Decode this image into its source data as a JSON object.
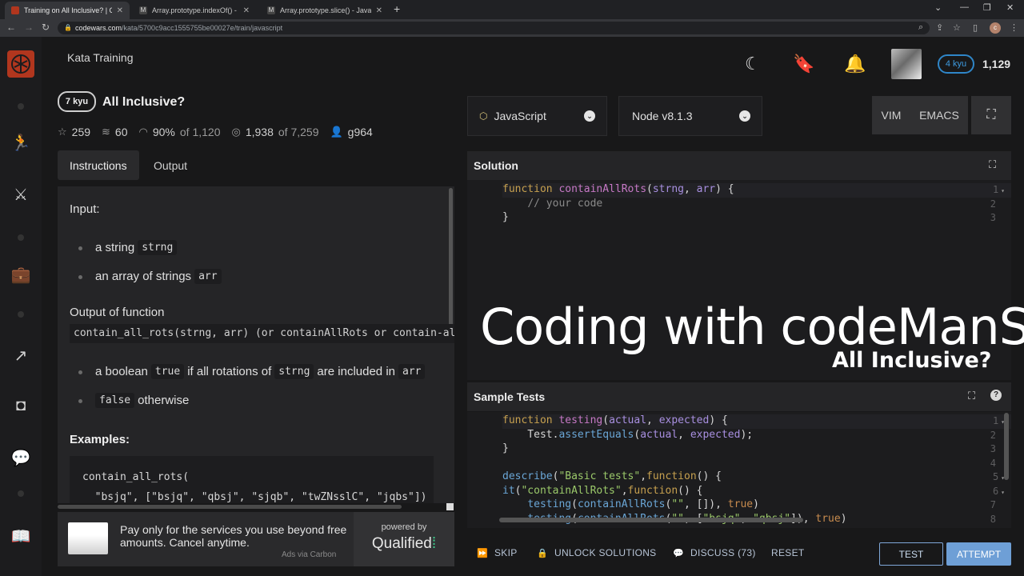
{
  "browser": {
    "tabs": [
      {
        "title": "Training on All Inclusive? | Codewars",
        "color": "#b1361e"
      },
      {
        "title": "Array.prototype.indexOf() - JavaScript",
        "color": "#444"
      },
      {
        "title": "Array.prototype.slice() - JavaScript",
        "color": "#444"
      }
    ],
    "url_host": "codewars.com",
    "url_path": "/kata/5700c9acc1555755be00027e/train/javascript"
  },
  "header": {
    "section_title": "Kata Training",
    "rank": "4 kyu",
    "honor": "1,129"
  },
  "kata": {
    "kyu": "7 kyu",
    "title": "All Inclusive?",
    "stats": {
      "stars": "259",
      "collections": "60",
      "satisfaction_pct": "90%",
      "satisfaction_of": "of 1,120",
      "completed": "1,938",
      "completed_of": "of 7,259",
      "author": "g964"
    }
  },
  "instruction_tabs": [
    "Instructions",
    "Output"
  ],
  "instructions": {
    "input_heading": "Input:",
    "input_items": [
      {
        "text": "a string",
        "code": "strng"
      },
      {
        "text": "an array of strings",
        "code": "arr"
      }
    ],
    "output_heading": "Output of function",
    "output_code": "contain_all_rots(strng, arr) (or containAllRots or contain-all-rots)",
    "output_items": [
      {
        "pre": "a boolean",
        "code1": "true",
        "mid": "if all rotations of",
        "code2": "strng",
        "post": "are included in",
        "code3": "arr"
      },
      {
        "code": "false",
        "text": "otherwise"
      }
    ],
    "examples_heading": "Examples:",
    "example_code": "contain_all_rots(\n  \"bsjq\", [\"bsjq\", \"qbsj\", \"sjqb\", \"twZNsslC\", \"jqbs\"]) -> true"
  },
  "ad": {
    "text": "Pay only for the services you use beyond free amounts. Cancel anytime.",
    "via": "Ads via Carbon",
    "powered": "powered by",
    "brand": "Qualified"
  },
  "editor": {
    "language": "JavaScript",
    "version": "Node v8.1.3",
    "modes": [
      "VIM",
      "EMACS"
    ],
    "solution_label": "Solution",
    "tests_label": "Sample Tests"
  },
  "overlay": {
    "title": "Coding with codeManS",
    "subtitle": "All Inclusive?"
  },
  "actions": {
    "skip": "SKIP",
    "unlock": "UNLOCK SOLUTIONS",
    "discuss": "DISCUSS (73)",
    "reset": "RESET",
    "test": "TEST",
    "attempt": "ATTEMPT"
  },
  "colors": {
    "brand": "#b1361e",
    "accent_blue": "#6e9fd6",
    "rank_blue": "#2f86c8"
  }
}
